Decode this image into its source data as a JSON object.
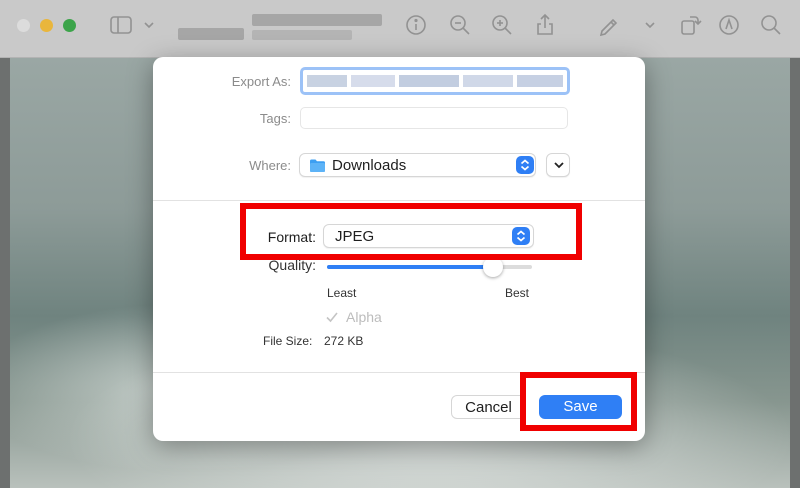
{
  "dialog": {
    "export_as_label": "Export As:",
    "tags_label": "Tags:",
    "where_label": "Where:",
    "where_value": "Downloads",
    "format_label": "Format:",
    "format_value": "JPEG",
    "quality_label": "Quality:",
    "quality_min_label": "Least",
    "quality_max_label": "Best",
    "quality_level": 0.81,
    "alpha_label": "Alpha",
    "alpha_checked": true,
    "alpha_enabled": false,
    "file_size_label": "File Size:",
    "file_size_value": "272 KB",
    "cancel_label": "Cancel",
    "save_label": "Save"
  },
  "icons": {
    "toolbar": [
      "sidebar-icon",
      "chevron-down-icon",
      "info-icon",
      "zoom-out-icon",
      "zoom-in-icon",
      "share-icon",
      "markup-pen-icon",
      "chevron-down-icon",
      "rotate-icon",
      "annotate-icon",
      "search-icon"
    ],
    "where": "folder-icon",
    "expand": "chevron-down-icon"
  },
  "colors": {
    "accent": "#2f7ff5",
    "highlight": "#f00000",
    "dialog_bg": "#ffffff"
  }
}
